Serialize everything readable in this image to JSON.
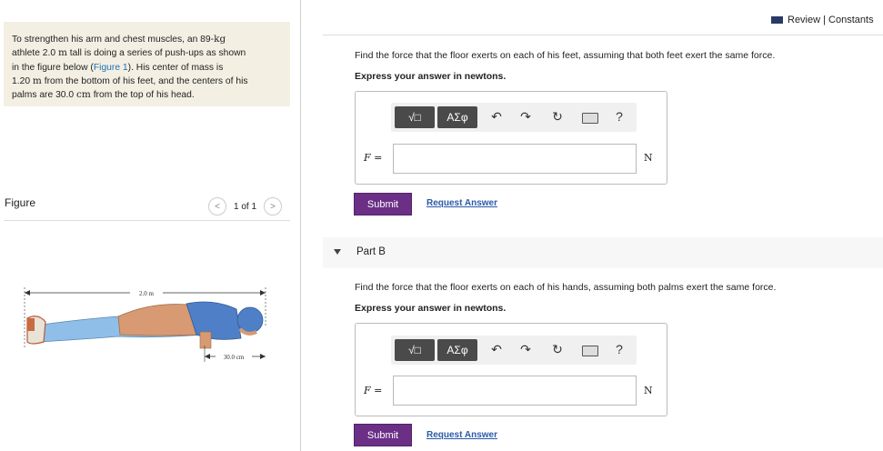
{
  "header": {
    "review_label": "Review | Constants"
  },
  "problem": {
    "line1_a": "To strengthen his arm and chest muscles, an 89-",
    "line1_unit": "kg",
    "line2_a": "athlete 2.0 ",
    "line2_unit": "m",
    "line2_b": " tall is doing a series of push-ups as shown",
    "line3_a": "in the figure below (",
    "line3_link": "Figure 1",
    "line3_b": "). His center of mass is",
    "line4_a": "1.20 ",
    "line4_unit": "m",
    "line4_b": " from the bottom of his feet, and the centers of his",
    "line5_a": "palms are 30.0 ",
    "line5_unit": "cm",
    "line5_b": " from the top of his head."
  },
  "figure": {
    "label": "Figure",
    "nav_prev": "<",
    "nav_next": ">",
    "counter": "1 of 1",
    "dim_total": "2.0 m",
    "dim_hands": "30.0 cm"
  },
  "partA": {
    "question": "Find the force that the floor exerts on each of his feet, assuming that both feet exert the same force.",
    "instruction": "Express your answer in newtons.",
    "var_label": "F =",
    "unit": "N",
    "input_value": "",
    "submit_label": "Submit",
    "request_label": "Request Answer"
  },
  "partB": {
    "title": "Part B",
    "question": "Find the force that the floor exerts on each of his hands, assuming both palms exert the same force.",
    "instruction": "Express your answer in newtons.",
    "var_label": "F =",
    "unit": "N",
    "input_value": "",
    "submit_label": "Submit",
    "request_label": "Request Answer"
  },
  "toolbar": {
    "template_label": "√□",
    "greek_label": "ΑΣφ",
    "undo": "↶",
    "redo": "↷",
    "reset": "↻",
    "help": "?"
  },
  "colors": {
    "accent": "#6b2f86",
    "link": "#2b5aa8",
    "problem_bg": "#f3f0e3"
  }
}
